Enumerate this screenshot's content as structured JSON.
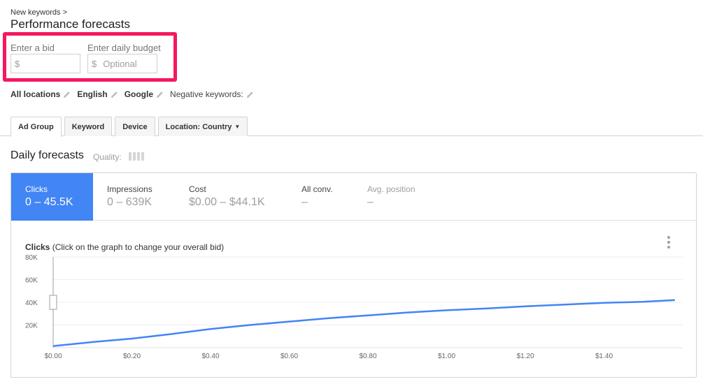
{
  "header": {
    "breadcrumb": "New keywords >",
    "title": "Performance forecasts"
  },
  "bid": {
    "label": "Enter a bid",
    "currency": "$",
    "value": "",
    "placeholder": ""
  },
  "budget": {
    "label": "Enter daily budget",
    "currency": "$",
    "value": "",
    "placeholder": "Optional"
  },
  "filters": [
    {
      "label": "All locations"
    },
    {
      "label": "English"
    },
    {
      "label": "Google"
    },
    {
      "label": "Negative keywords:"
    }
  ],
  "tabs": [
    {
      "label": "Ad Group",
      "active": true
    },
    {
      "label": "Keyword",
      "active": false
    },
    {
      "label": "Device",
      "active": false
    },
    {
      "label": "Location: Country",
      "active": false
    }
  ],
  "forecasts": {
    "title": "Daily forecasts",
    "quality_label": "Quality:",
    "metrics": [
      {
        "label": "Clicks",
        "value": "0 – 45.5K",
        "active": true
      },
      {
        "label": "Impressions",
        "value": "0 – 639K",
        "active": false
      },
      {
        "label": "Cost",
        "value": "$0.00 – $44.1K",
        "active": false
      },
      {
        "label": "All conv.",
        "value": "–",
        "active": false
      },
      {
        "label": "Avg. position",
        "value": "–",
        "active": false
      }
    ]
  },
  "chart_data": {
    "type": "line",
    "title": "Clicks",
    "subtitle": "(Click on the graph to change your overall bid)",
    "xlabel": "",
    "ylabel": "",
    "xlim": [
      0,
      1.6
    ],
    "ylim": [
      0,
      80000
    ],
    "x_ticks": [
      "$0.00",
      "$0.20",
      "$0.40",
      "$0.60",
      "$0.80",
      "$1.00",
      "$1.20",
      "$1.40"
    ],
    "x_tick_values": [
      0,
      0.2,
      0.4,
      0.6,
      0.8,
      1.0,
      1.2,
      1.4
    ],
    "y_ticks": [
      "80K",
      "60K",
      "40K",
      "20K"
    ],
    "y_tick_values": [
      80000,
      60000,
      40000,
      20000
    ],
    "grid": true,
    "series_color": "#4285f4",
    "series": [
      {
        "x": [
          0,
          0.1,
          0.2,
          0.3,
          0.4,
          0.5,
          0.6,
          0.7,
          0.8,
          0.9,
          1.0,
          1.1,
          1.2,
          1.3,
          1.4,
          1.5,
          1.58
        ],
        "y": [
          1500,
          5000,
          8000,
          12000,
          16500,
          20000,
          23000,
          26000,
          28500,
          31000,
          33000,
          34500,
          36500,
          38000,
          39500,
          40500,
          42000
        ]
      }
    ],
    "current_bid_marker": 0
  }
}
